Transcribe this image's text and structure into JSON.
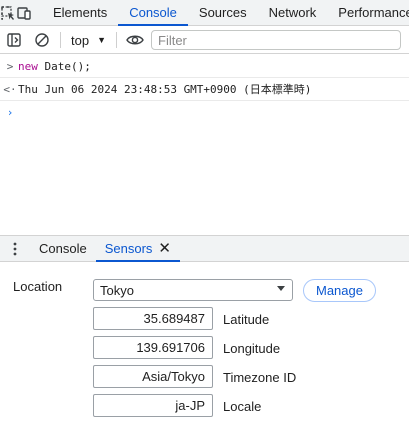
{
  "top_tabs": [
    {
      "label": "Elements"
    },
    {
      "label": "Console"
    },
    {
      "label": "Sources"
    },
    {
      "label": "Network"
    },
    {
      "label": "Performance"
    }
  ],
  "toolbar": {
    "context": "top",
    "filter_placeholder": "Filter"
  },
  "console": {
    "input": {
      "keyword": "new",
      "rest": " Date();"
    },
    "output": "Thu Jun 06 2024 23:48:53 GMT+0900 (日本標準時)"
  },
  "drawer": {
    "tabs": [
      {
        "label": "Console"
      },
      {
        "label": "Sensors"
      }
    ]
  },
  "sensors": {
    "location_label": "Location",
    "location_value": "Tokyo",
    "manage_label": "Manage",
    "fields": [
      {
        "value": "35.689487",
        "label": "Latitude"
      },
      {
        "value": "139.691706",
        "label": "Longitude"
      },
      {
        "value": "Asia/Tokyo",
        "label": "Timezone ID"
      },
      {
        "value": "ja-JP",
        "label": "Locale"
      }
    ]
  },
  "colors": {
    "accent": "#0b57d0",
    "keyword": "#aa0d91",
    "toolbar_bg": "#f1f3f4"
  }
}
